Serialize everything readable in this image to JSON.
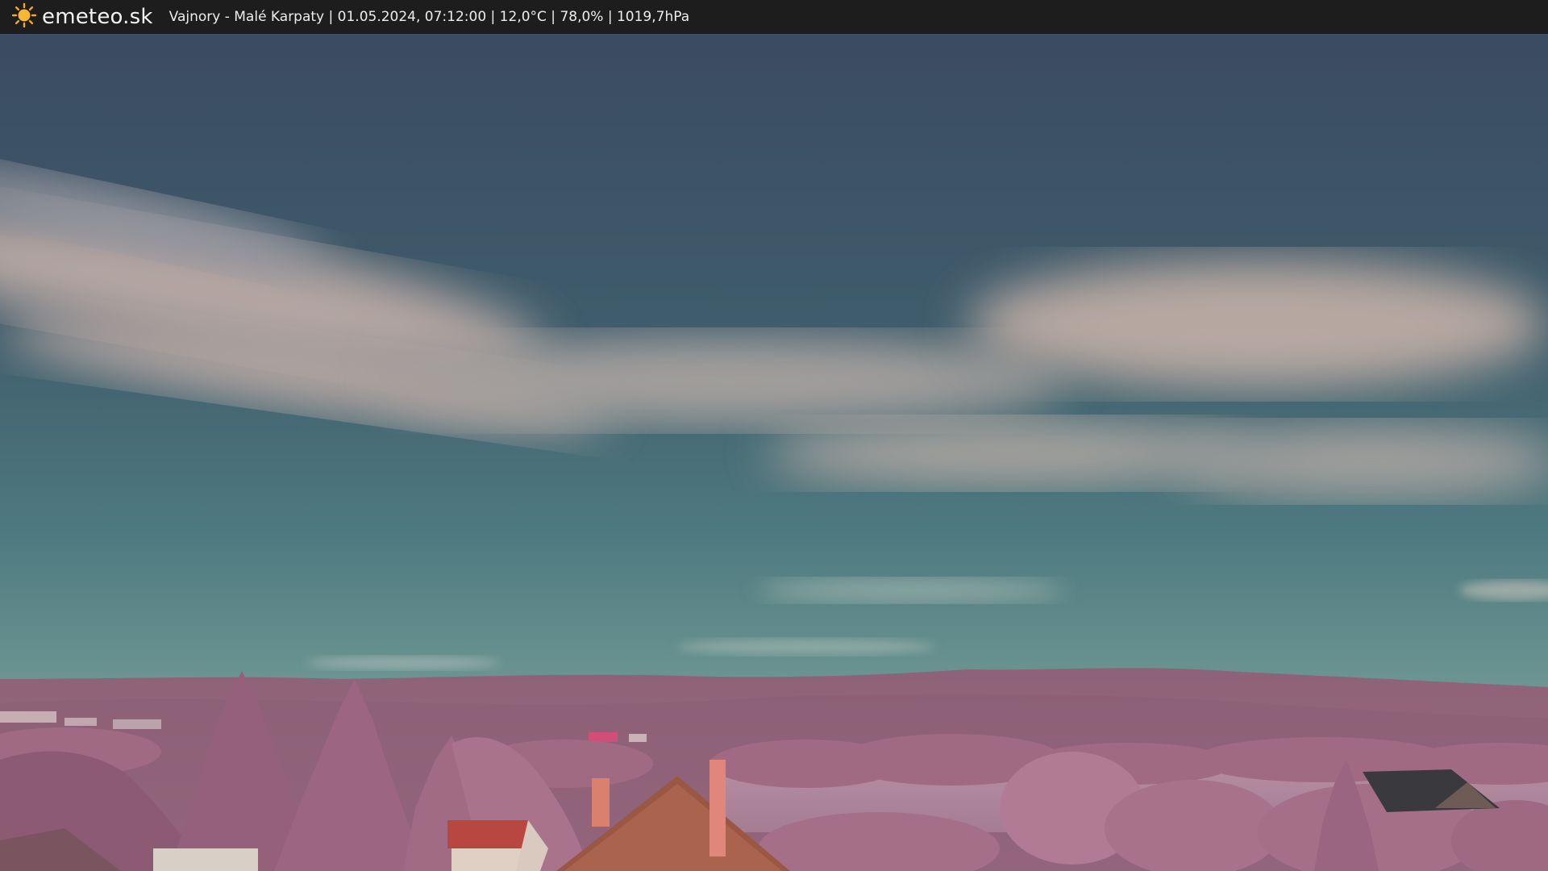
{
  "header": {
    "logo_text": "emeteo.sk",
    "logo_icon": "sun-icon",
    "caption": "Vajnory - Malé Karpaty | 01.05.2024, 07:12:00 | 12,0°C | 78,0% | 1019,7hPa"
  },
  "colors": {
    "bar_background": "#1d1d1d",
    "logo_accent": "#f5a623",
    "sky_top": "#3d4f63",
    "sky_bottom": "#6f9794",
    "vegetation": "#a56f86"
  }
}
